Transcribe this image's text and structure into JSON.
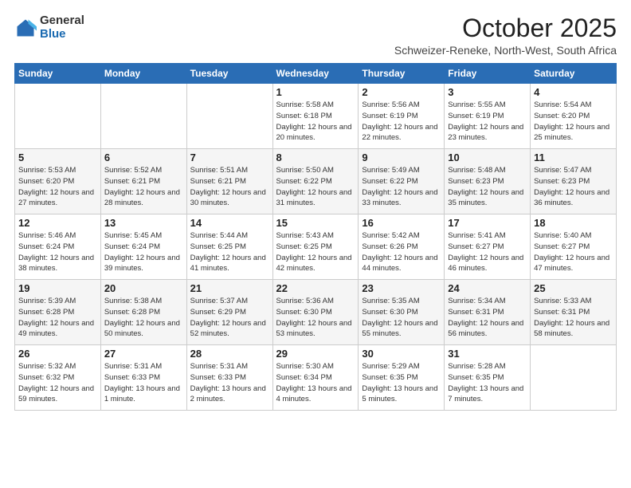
{
  "logo": {
    "line1": "General",
    "line2": "Blue"
  },
  "title": "October 2025",
  "subtitle": "Schweizer-Reneke, North-West, South Africa",
  "weekdays": [
    "Sunday",
    "Monday",
    "Tuesday",
    "Wednesday",
    "Thursday",
    "Friday",
    "Saturday"
  ],
  "weeks": [
    [
      {
        "day": "",
        "info": ""
      },
      {
        "day": "",
        "info": ""
      },
      {
        "day": "",
        "info": ""
      },
      {
        "day": "1",
        "info": "Sunrise: 5:58 AM\nSunset: 6:18 PM\nDaylight: 12 hours\nand 20 minutes."
      },
      {
        "day": "2",
        "info": "Sunrise: 5:56 AM\nSunset: 6:19 PM\nDaylight: 12 hours\nand 22 minutes."
      },
      {
        "day": "3",
        "info": "Sunrise: 5:55 AM\nSunset: 6:19 PM\nDaylight: 12 hours\nand 23 minutes."
      },
      {
        "day": "4",
        "info": "Sunrise: 5:54 AM\nSunset: 6:20 PM\nDaylight: 12 hours\nand 25 minutes."
      }
    ],
    [
      {
        "day": "5",
        "info": "Sunrise: 5:53 AM\nSunset: 6:20 PM\nDaylight: 12 hours\nand 27 minutes."
      },
      {
        "day": "6",
        "info": "Sunrise: 5:52 AM\nSunset: 6:21 PM\nDaylight: 12 hours\nand 28 minutes."
      },
      {
        "day": "7",
        "info": "Sunrise: 5:51 AM\nSunset: 6:21 PM\nDaylight: 12 hours\nand 30 minutes."
      },
      {
        "day": "8",
        "info": "Sunrise: 5:50 AM\nSunset: 6:22 PM\nDaylight: 12 hours\nand 31 minutes."
      },
      {
        "day": "9",
        "info": "Sunrise: 5:49 AM\nSunset: 6:22 PM\nDaylight: 12 hours\nand 33 minutes."
      },
      {
        "day": "10",
        "info": "Sunrise: 5:48 AM\nSunset: 6:23 PM\nDaylight: 12 hours\nand 35 minutes."
      },
      {
        "day": "11",
        "info": "Sunrise: 5:47 AM\nSunset: 6:23 PM\nDaylight: 12 hours\nand 36 minutes."
      }
    ],
    [
      {
        "day": "12",
        "info": "Sunrise: 5:46 AM\nSunset: 6:24 PM\nDaylight: 12 hours\nand 38 minutes."
      },
      {
        "day": "13",
        "info": "Sunrise: 5:45 AM\nSunset: 6:24 PM\nDaylight: 12 hours\nand 39 minutes."
      },
      {
        "day": "14",
        "info": "Sunrise: 5:44 AM\nSunset: 6:25 PM\nDaylight: 12 hours\nand 41 minutes."
      },
      {
        "day": "15",
        "info": "Sunrise: 5:43 AM\nSunset: 6:25 PM\nDaylight: 12 hours\nand 42 minutes."
      },
      {
        "day": "16",
        "info": "Sunrise: 5:42 AM\nSunset: 6:26 PM\nDaylight: 12 hours\nand 44 minutes."
      },
      {
        "day": "17",
        "info": "Sunrise: 5:41 AM\nSunset: 6:27 PM\nDaylight: 12 hours\nand 46 minutes."
      },
      {
        "day": "18",
        "info": "Sunrise: 5:40 AM\nSunset: 6:27 PM\nDaylight: 12 hours\nand 47 minutes."
      }
    ],
    [
      {
        "day": "19",
        "info": "Sunrise: 5:39 AM\nSunset: 6:28 PM\nDaylight: 12 hours\nand 49 minutes."
      },
      {
        "day": "20",
        "info": "Sunrise: 5:38 AM\nSunset: 6:28 PM\nDaylight: 12 hours\nand 50 minutes."
      },
      {
        "day": "21",
        "info": "Sunrise: 5:37 AM\nSunset: 6:29 PM\nDaylight: 12 hours\nand 52 minutes."
      },
      {
        "day": "22",
        "info": "Sunrise: 5:36 AM\nSunset: 6:30 PM\nDaylight: 12 hours\nand 53 minutes."
      },
      {
        "day": "23",
        "info": "Sunrise: 5:35 AM\nSunset: 6:30 PM\nDaylight: 12 hours\nand 55 minutes."
      },
      {
        "day": "24",
        "info": "Sunrise: 5:34 AM\nSunset: 6:31 PM\nDaylight: 12 hours\nand 56 minutes."
      },
      {
        "day": "25",
        "info": "Sunrise: 5:33 AM\nSunset: 6:31 PM\nDaylight: 12 hours\nand 58 minutes."
      }
    ],
    [
      {
        "day": "26",
        "info": "Sunrise: 5:32 AM\nSunset: 6:32 PM\nDaylight: 12 hours\nand 59 minutes."
      },
      {
        "day": "27",
        "info": "Sunrise: 5:31 AM\nSunset: 6:33 PM\nDaylight: 13 hours\nand 1 minute."
      },
      {
        "day": "28",
        "info": "Sunrise: 5:31 AM\nSunset: 6:33 PM\nDaylight: 13 hours\nand 2 minutes."
      },
      {
        "day": "29",
        "info": "Sunrise: 5:30 AM\nSunset: 6:34 PM\nDaylight: 13 hours\nand 4 minutes."
      },
      {
        "day": "30",
        "info": "Sunrise: 5:29 AM\nSunset: 6:35 PM\nDaylight: 13 hours\nand 5 minutes."
      },
      {
        "day": "31",
        "info": "Sunrise: 5:28 AM\nSunset: 6:35 PM\nDaylight: 13 hours\nand 7 minutes."
      },
      {
        "day": "",
        "info": ""
      }
    ]
  ]
}
